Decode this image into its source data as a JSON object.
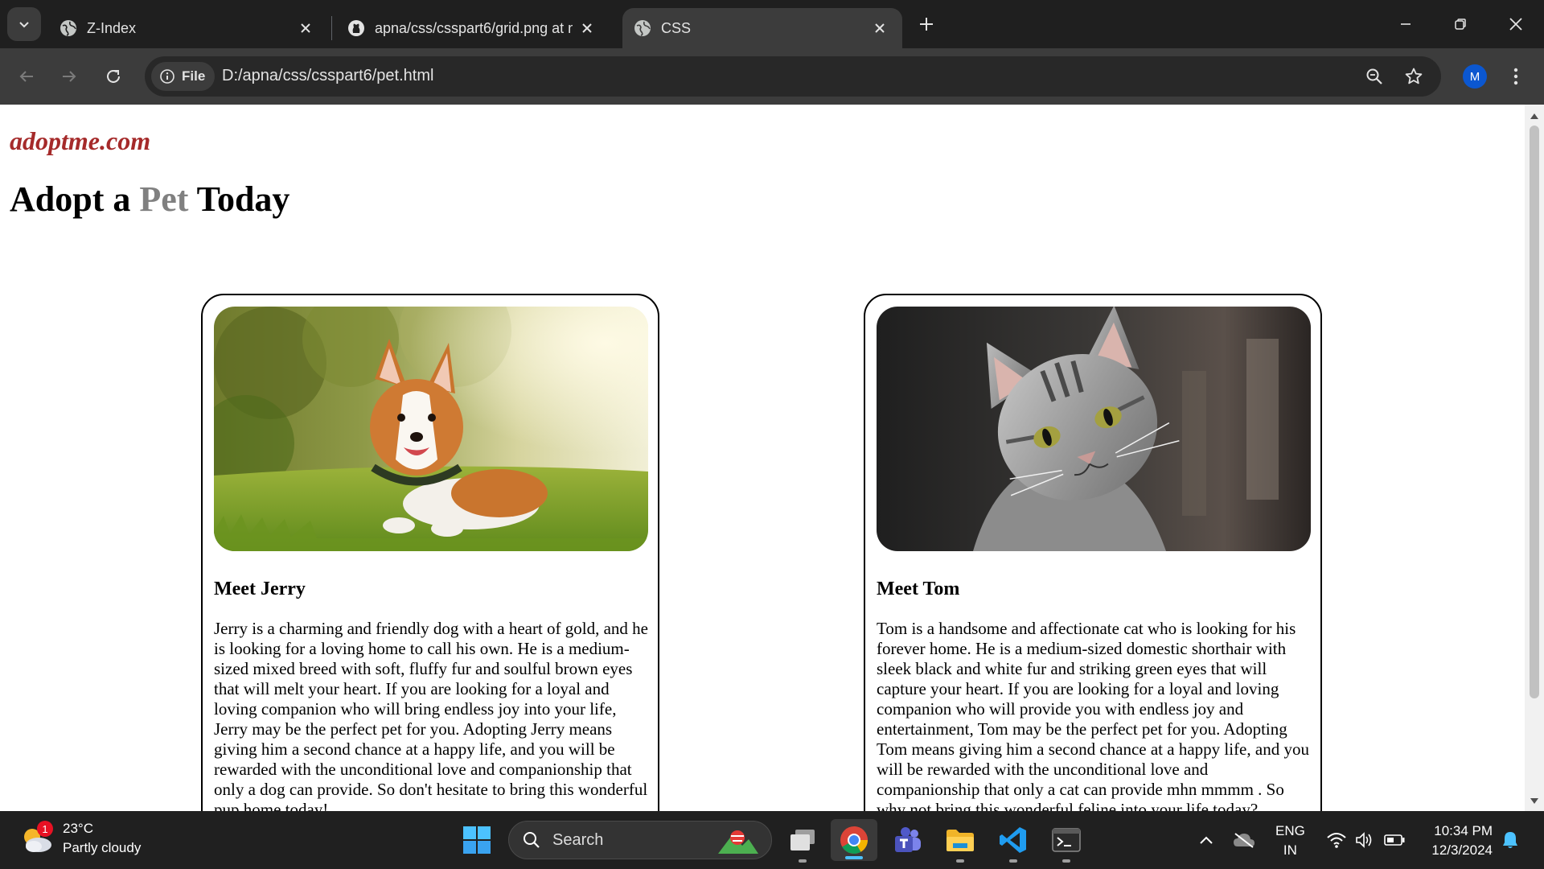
{
  "browser": {
    "tabs": [
      {
        "title": "Z-Index",
        "favicon": "globe-icon",
        "active": false
      },
      {
        "title": "apna/css/csspart6/grid.png at m",
        "favicon": "github-icon",
        "active": false
      },
      {
        "title": "CSS",
        "favicon": "globe-icon",
        "active": true
      }
    ],
    "site_chip_label": "File",
    "url": "D:/apna/css/csspart6/pet.html",
    "profile_initial": "M"
  },
  "page": {
    "site_name": "adoptme.com",
    "headline": {
      "part1": "Adopt a ",
      "accent": "Pet",
      "part2": " Today"
    },
    "colors": {
      "site_name": "#a52a2a",
      "accent": "#808080"
    },
    "pets": [
      {
        "name": "Meet Jerry",
        "photo": "corgi-dog-photo",
        "bio": "Jerry is a charming and friendly dog with a heart of gold, and he is looking for a loving home to call his own. He is a medium-sized mixed breed with soft, fluffy fur and soulful brown eyes that will melt your heart. If you are looking for a loyal and loving companion who will bring endless joy into your life, Jerry may be the perfect pet for you. Adopting Jerry means giving him a second chance at a happy life, and you will be rewarded with the unconditional love and companionship that only a dog can provide. So don't hesitate to bring this wonderful pup home today!"
      },
      {
        "name": "Meet Tom",
        "photo": "grey-tabby-cat-photo",
        "bio": "Tom is a handsome and affectionate cat who is looking for his forever home. He is a medium-sized domestic shorthair with sleek black and white fur and striking green eyes that will capture your heart. If you are looking for a loyal and loving companion who will provide you with endless joy and entertainment, Tom may be the perfect pet for you. Adopting Tom means giving him a second chance at a happy life, and you will be rewarded with the unconditional love and companionship that only a cat can provide mhn mmmm . So why not bring this wonderful feline into your life today?"
      }
    ]
  },
  "taskbar": {
    "weather": {
      "temp": "23°C",
      "condition": "Partly cloudy",
      "badge": "1"
    },
    "search_label": "Search",
    "lang": {
      "line1": "ENG",
      "line2": "IN"
    },
    "clock": {
      "time": "10:34 PM",
      "date": "12/3/2024"
    }
  }
}
